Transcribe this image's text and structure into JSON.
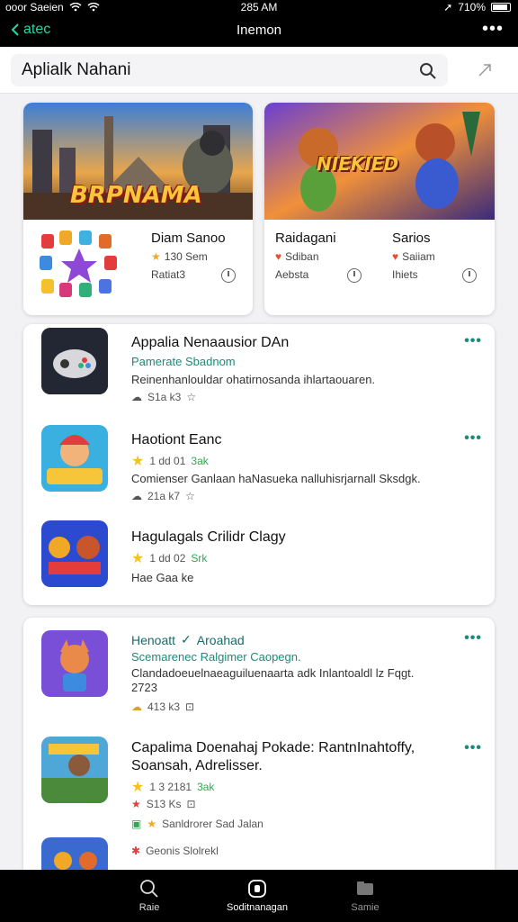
{
  "status": {
    "left": "ooor Saeien",
    "time": "285 AM",
    "battery": "710%"
  },
  "nav": {
    "back_label": "atec",
    "title": "Inemon"
  },
  "search": {
    "query": "Aplialk Nahani"
  },
  "featured": [
    {
      "banner_title": "BRPNAMA",
      "name": "Diam Sanoo",
      "rating": "130 Sem",
      "version": "Ratiat3"
    },
    {
      "banner_title": "NIEKIED",
      "name": "Raidagani",
      "rating": "Sdiban",
      "version": "Aebsta",
      "name2": "Sarios",
      "rating2": "Saiiam",
      "version2": "Ihiets"
    }
  ],
  "list1": [
    {
      "name": "Appalia Nenaausior DAn",
      "sub": "Pamerate Sbadnom",
      "desc": "Reinenhanlouldar ohatirnosanda ihlartaouaren.",
      "meta": "S1a k3"
    },
    {
      "name": "Haotiont Eanc",
      "rating": "1 dd 01",
      "ok": "3ak",
      "desc": "Comienser Ganlaan haNasueka nalluhisrjarnall Sksdgk.",
      "meta": "21a k7"
    },
    {
      "name": "Hagulagals Crilidr Clagy",
      "rating": "1 dd 02",
      "ok": "Srk",
      "desc": "Hae Gaa ke"
    }
  ],
  "list2": [
    {
      "name": "Henoatt",
      "badge": "Aroahad",
      "sub": "Scemarenec Ralgimer Caopegn.",
      "desc": "Clandadoeuelnaeaguiluenaarta adk Inlantoaldl lz Fqgt.",
      "extra": "2723",
      "meta": "413 k3"
    },
    {
      "name": "Capalima Doenahaj Pokade: RantnInahtoffy,",
      "name2": "Soansah, Adrelisser.",
      "rating": "1 3 2181",
      "ok": "3ak",
      "meta": "S13 Ks",
      "tags": "Sanldrorer Sad Jalan"
    },
    {
      "name": "Geonis Slolrekl"
    }
  ],
  "tabs": [
    {
      "label": "Raie"
    },
    {
      "label": "Soditnanagan"
    },
    {
      "label": "Samie"
    }
  ]
}
